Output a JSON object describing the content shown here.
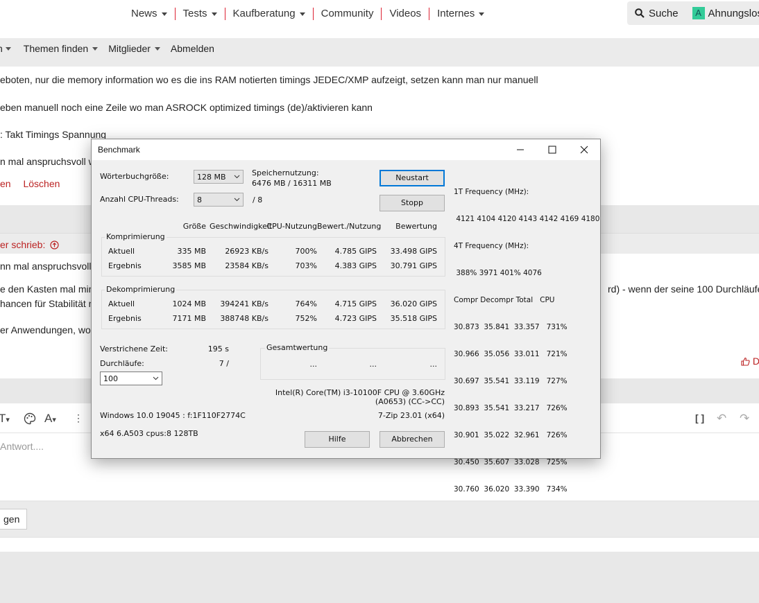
{
  "forum": {
    "nav": [
      "News",
      "Tests",
      "Kaufberatung",
      "Community",
      "Videos",
      "Internes"
    ],
    "nav_dropdowns": [
      true,
      true,
      true,
      false,
      false,
      true
    ],
    "search_label": "Suche",
    "user_initial": "A",
    "user_name": "Ahnungslos",
    "subnav_partial": "n",
    "subnav": [
      "Themen finden",
      "Mitglieder",
      "Abmelden"
    ],
    "post1_lines": [
      "eboten, nur die memory information wo es die ins RAM notierten timings JEDEC/XMP aufzeigt, setzen kann man nur manuell",
      "eben manuell noch eine Zeile wo man ASROCK optimized timings (de)/aktivieren kann",
      ": Takt Timings Spannung",
      "n mal anspruchsvoll w"
    ],
    "post1_link_partial": "en",
    "post1_delete": "Löschen",
    "quote_header": "er schrieb:",
    "post2_lines": [
      "nn mal anspruchsvoll wi",
      "e den Kasten mal mind",
      "hancen für Stabilität n",
      "er Anwendungen, wo s"
    ],
    "post2_right": "rd) - wenn der seine 100 Durchläufe d",
    "like_partial": "D",
    "editor_placeholder": "Antwort....",
    "bottom_button_partial": "gen"
  },
  "dialog": {
    "title": "Benchmark",
    "dict_label": "Wörterbuchgröße:",
    "dict_value": "128 MB",
    "threads_label": "Anzahl CPU-Threads:",
    "threads_value": "8",
    "threads_max": "/ 8",
    "mem_label": "Speichernutzung:",
    "mem_value": "6476 MB / 16311 MB",
    "btn_restart": "Neustart",
    "btn_stop": "Stopp",
    "headers": {
      "size": "Größe",
      "speed": "Geschwindigkeit",
      "cpu": "CPU-Nutzung",
      "rating_usage": "Bewert./Nutzung",
      "rating": "Bewertung"
    },
    "compress": {
      "label": "Komprimierung",
      "rows": [
        {
          "name": "Aktuell",
          "size": "335 MB",
          "speed": "26923 KB/s",
          "cpu": "700%",
          "ru": "4.785 GIPS",
          "rating": "33.498 GIPS"
        },
        {
          "name": "Ergebnis",
          "size": "3585 MB",
          "speed": "23584 KB/s",
          "cpu": "703%",
          "ru": "4.383 GIPS",
          "rating": "30.791 GIPS"
        }
      ]
    },
    "decompress": {
      "label": "Dekomprimierung",
      "rows": [
        {
          "name": "Aktuell",
          "size": "1024 MB",
          "speed": "394241 KB/s",
          "cpu": "764%",
          "ru": "4.715 GIPS",
          "rating": "36.020 GIPS"
        },
        {
          "name": "Ergebnis",
          "size": "7171 MB",
          "speed": "388748 KB/s",
          "cpu": "752%",
          "ru": "4.723 GIPS",
          "rating": "35.518 GIPS"
        }
      ]
    },
    "elapsed_label": "Verstrichene Zeit:",
    "elapsed_value": "195 s",
    "passes_label": "Durchläufe:",
    "passes_value": "7 /",
    "passes_select": "100",
    "total_label": "Gesamtwertung",
    "total_values": [
      "...",
      "...",
      "..."
    ],
    "cpu_name": "Intel(R) Core(TM) i3-10100F CPU @ 3.60GHz",
    "cpu_id": "(A0653) (CC->CC)",
    "os": "Windows 10.0 19045 : f:1F110F2774C",
    "version": "7-Zip 23.01 (x64)",
    "arch": "x64 6.A503 cpus:8 128TB",
    "btn_help": "Hilfe",
    "btn_cancel": "Abbrechen",
    "freq_lines": [
      "1T Frequency (MHz):",
      " 4121 4104 4120 4143 4142 4169 4180",
      "4T Frequency (MHz):",
      " 388% 3971 401% 4076",
      "Compr Decompr Total   CPU",
      "30.873  35.841  33.357   731%",
      "30.966  35.056  33.011   721%",
      "30.697  35.541  33.119   727%",
      "30.893  35.541  33.217   726%",
      "30.901  35.022  32.961   726%",
      "30.450  35.607  33.028   725%",
      "30.760  36.020  33.390   734%"
    ]
  }
}
